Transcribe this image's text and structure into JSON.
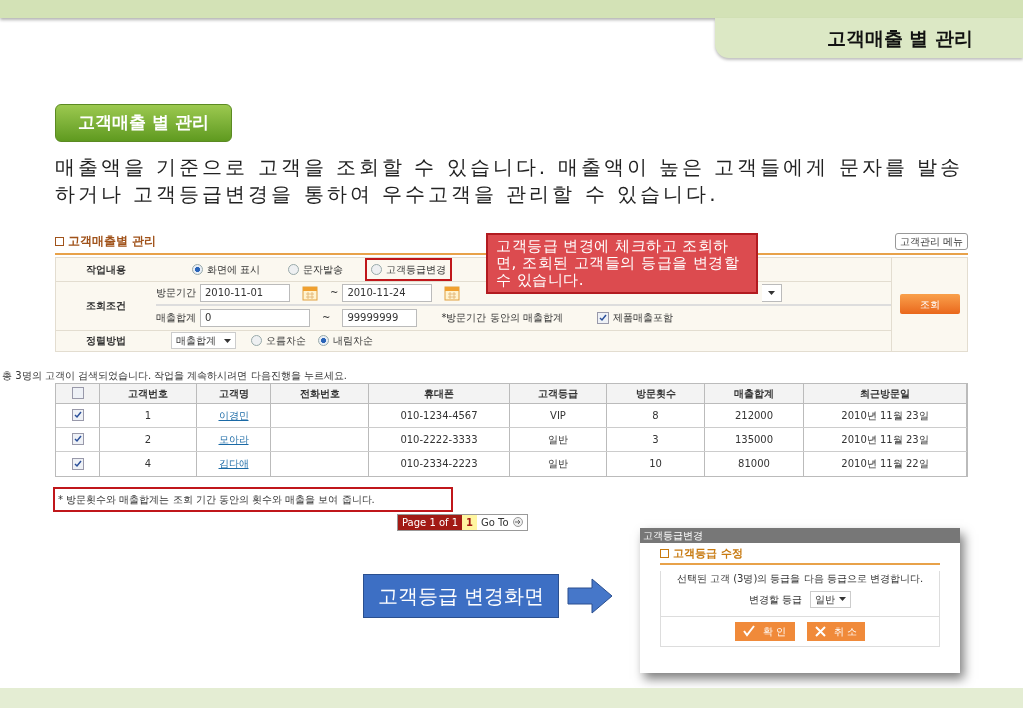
{
  "header_tab": "고객매출 별 관리",
  "section_badge": "고객매출 별 관리",
  "description": "매출액을 기준으로 고객을 조회할 수 있습니다. 매출액이 높은 고객들에게 문자를 발송하거나 고객등급변경을 통하여 우수고객을 관리할 수 있습니다.",
  "panel": {
    "title": "고객매출별 관리",
    "menu_button": "고객관리 메뉴",
    "task": {
      "label": "작업내용",
      "options": [
        {
          "label": "화면에 표시",
          "selected": true,
          "highlighted": false
        },
        {
          "label": "문자발송",
          "selected": false,
          "highlighted": false
        },
        {
          "label": "고객등급변경",
          "selected": false,
          "highlighted": true
        }
      ]
    },
    "query": {
      "label": "조회조건",
      "period_label": "방문기간",
      "from": "2010-11-01",
      "period_sep": "~",
      "to": "2010-11-24",
      "total_label": "매출합계",
      "min": "0",
      "total_sep": "~",
      "max": "99999999",
      "total_note": "*방문기간 동안의 매출합계",
      "include": {
        "label": "제품매출포함",
        "checked": true
      }
    },
    "sort": {
      "label": "정렬방법",
      "field": "매출합계",
      "options": [
        {
          "label": "오름차순",
          "selected": false
        },
        {
          "label": "내림차순",
          "selected": true
        }
      ]
    },
    "search_button": "조회"
  },
  "callout": "고객등급 변경에 체크하고 조회하면, 조회된 고객들의 등급을 변경할 수 있습니다.",
  "result_message": "총 3명의 고객이 검색되었습니다. 작업을 계속하시려면 다음진행을 누르세요.",
  "table": {
    "all_checked": false,
    "columns": [
      "고객번호",
      "고객명",
      "전화번호",
      "휴대폰",
      "고객등급",
      "방문횟수",
      "매출합계",
      "최근방문일"
    ],
    "rows": [
      {
        "checked": true,
        "cells": [
          "1",
          "이경민",
          "",
          "010-1234-4567",
          "VIP",
          "8",
          "212000",
          "2010년 11월 23일"
        ]
      },
      {
        "checked": true,
        "cells": [
          "2",
          "모아라",
          "",
          "010-2222-3333",
          "일반",
          "3",
          "135000",
          "2010년 11월 23일"
        ]
      },
      {
        "checked": true,
        "cells": [
          "4",
          "김다애",
          "",
          "010-2334-2223",
          "일반",
          "10",
          "81000",
          "2010년 11월 22일"
        ]
      }
    ]
  },
  "note": "* 방문횟수와 매출합계는 조회 기간 동안의 횟수와 매출을 보여 줍니다.",
  "pagination": {
    "page_info": "Page 1 of 1",
    "current": "1",
    "goto": "Go To"
  },
  "caption": "고객등급 변경화면",
  "dialog": {
    "title": "고객등급변경",
    "heading": "고객등급 수정",
    "message": "선택된 고객 (3명)의 등급을 다음 등급으로 변경합니다.",
    "grade_label": "변경할 등급",
    "grade_value": "일반",
    "ok": "확 인",
    "cancel": "취 소"
  }
}
